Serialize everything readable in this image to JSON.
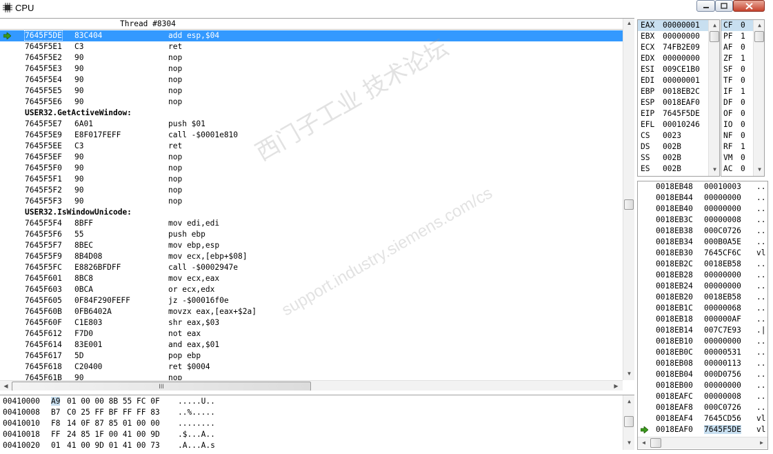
{
  "window": {
    "title": "CPU"
  },
  "disasm": {
    "header": "Thread #8304",
    "lines": [
      {
        "addr": "7645F5DE",
        "bytes": "83C404",
        "instr": "add esp,$04",
        "sel": true
      },
      {
        "addr": "7645F5E1",
        "bytes": "C3",
        "instr": "ret"
      },
      {
        "addr": "7645F5E2",
        "bytes": "90",
        "instr": "nop"
      },
      {
        "addr": "7645F5E3",
        "bytes": "90",
        "instr": "nop"
      },
      {
        "addr": "7645F5E4",
        "bytes": "90",
        "instr": "nop"
      },
      {
        "addr": "7645F5E5",
        "bytes": "90",
        "instr": "nop"
      },
      {
        "addr": "7645F5E6",
        "bytes": "90",
        "instr": "nop"
      },
      {
        "label": "USER32.GetActiveWindow:"
      },
      {
        "addr": "7645F5E7",
        "bytes": "6A01",
        "instr": "push $01"
      },
      {
        "addr": "7645F5E9",
        "bytes": "E8F017FEFF",
        "instr": "call -$0001e810"
      },
      {
        "addr": "7645F5EE",
        "bytes": "C3",
        "instr": "ret"
      },
      {
        "addr": "7645F5EF",
        "bytes": "90",
        "instr": "nop"
      },
      {
        "addr": "7645F5F0",
        "bytes": "90",
        "instr": "nop"
      },
      {
        "addr": "7645F5F1",
        "bytes": "90",
        "instr": "nop"
      },
      {
        "addr": "7645F5F2",
        "bytes": "90",
        "instr": "nop"
      },
      {
        "addr": "7645F5F3",
        "bytes": "90",
        "instr": "nop"
      },
      {
        "label": "USER32.IsWindowUnicode:"
      },
      {
        "addr": "7645F5F4",
        "bytes": "8BFF",
        "instr": "mov edi,edi"
      },
      {
        "addr": "7645F5F6",
        "bytes": "55",
        "instr": "push ebp"
      },
      {
        "addr": "7645F5F7",
        "bytes": "8BEC",
        "instr": "mov ebp,esp"
      },
      {
        "addr": "7645F5F9",
        "bytes": "8B4D08",
        "instr": "mov ecx,[ebp+$08]"
      },
      {
        "addr": "7645F5FC",
        "bytes": "E8826BFDFF",
        "instr": "call -$0002947e"
      },
      {
        "addr": "7645F601",
        "bytes": "8BC8",
        "instr": "mov ecx,eax"
      },
      {
        "addr": "7645F603",
        "bytes": "0BCA",
        "instr": "or ecx,edx"
      },
      {
        "addr": "7645F605",
        "bytes": "0F84F290FEFF",
        "instr": "jz -$00016f0e"
      },
      {
        "addr": "7645F60B",
        "bytes": "0FB6402A",
        "instr": "movzx eax,[eax+$2a]"
      },
      {
        "addr": "7645F60F",
        "bytes": "C1E803",
        "instr": "shr eax,$03"
      },
      {
        "addr": "7645F612",
        "bytes": "F7D0",
        "instr": "not eax"
      },
      {
        "addr": "7645F614",
        "bytes": "83E001",
        "instr": "and eax,$01"
      },
      {
        "addr": "7645F617",
        "bytes": "5D",
        "instr": "pop ebp"
      },
      {
        "addr": "7645F618",
        "bytes": "C20400",
        "instr": "ret $0004"
      },
      {
        "addr": "7645F61B",
        "bytes": "90",
        "instr": "nop"
      }
    ],
    "hscroll_grip": "III"
  },
  "dump": {
    "rows": [
      {
        "addr": "00410000",
        "first": "A9",
        "rest": "01 00 00 8B 55 FC 0F",
        "ascii": ".....U.."
      },
      {
        "addr": "00410008",
        "first": "B7",
        "rest": "C0 25 FF BF FF FF 83",
        "ascii": "..%....."
      },
      {
        "addr": "00410010",
        "first": "F8",
        "rest": "14 0F 87 85 01 00 00",
        "ascii": "........"
      },
      {
        "addr": "00410018",
        "first": "FF",
        "rest": "24 85 1F 00 41 00 9D",
        "ascii": ".$...A.."
      },
      {
        "addr": "00410020",
        "first": "01",
        "rest": "41 00 9D 01 41 00 73",
        "ascii": ".A...A.s"
      }
    ]
  },
  "registers": [
    {
      "name": "EAX",
      "value": "00000001",
      "hl": true
    },
    {
      "name": "EBX",
      "value": "00000000"
    },
    {
      "name": "ECX",
      "value": "74FB2E09"
    },
    {
      "name": "EDX",
      "value": "00000000"
    },
    {
      "name": "ESI",
      "value": "009CE1B0"
    },
    {
      "name": "EDI",
      "value": "00000001"
    },
    {
      "name": "EBP",
      "value": "0018EB2C"
    },
    {
      "name": "ESP",
      "value": "0018EAF0"
    },
    {
      "name": "EIP",
      "value": "7645F5DE"
    },
    {
      "name": "EFL",
      "value": "00010246"
    },
    {
      "name": "CS",
      "value": "0023"
    },
    {
      "name": "DS",
      "value": "002B"
    },
    {
      "name": "SS",
      "value": "002B"
    },
    {
      "name": "ES",
      "value": "002B"
    }
  ],
  "flags": [
    {
      "name": "CF",
      "value": "0",
      "hl": true
    },
    {
      "name": "PF",
      "value": "1"
    },
    {
      "name": "AF",
      "value": "0"
    },
    {
      "name": "ZF",
      "value": "1"
    },
    {
      "name": "SF",
      "value": "0"
    },
    {
      "name": "TF",
      "value": "0"
    },
    {
      "name": "IF",
      "value": "1"
    },
    {
      "name": "DF",
      "value": "0"
    },
    {
      "name": "OF",
      "value": "0"
    },
    {
      "name": "IO",
      "value": "0"
    },
    {
      "name": "NF",
      "value": "0"
    },
    {
      "name": "RF",
      "value": "1"
    },
    {
      "name": "VM",
      "value": "0"
    },
    {
      "name": "AC",
      "value": "0"
    }
  ],
  "stack": [
    {
      "addr": "0018EB48",
      "value": "00010003",
      "ascii": ".."
    },
    {
      "addr": "0018EB44",
      "value": "00000000",
      "ascii": ".."
    },
    {
      "addr": "0018EB40",
      "value": "00000000",
      "ascii": ".."
    },
    {
      "addr": "0018EB3C",
      "value": "00000008",
      "ascii": ".."
    },
    {
      "addr": "0018EB38",
      "value": "000C0726",
      "ascii": ".."
    },
    {
      "addr": "0018EB34",
      "value": "000B0A5E",
      "ascii": ".."
    },
    {
      "addr": "0018EB30",
      "value": "7645CF6C",
      "ascii": "vl"
    },
    {
      "addr": "0018EB2C",
      "value": "0018EB58",
      "ascii": ".."
    },
    {
      "addr": "0018EB28",
      "value": "00000000",
      "ascii": ".."
    },
    {
      "addr": "0018EB24",
      "value": "00000000",
      "ascii": ".."
    },
    {
      "addr": "0018EB20",
      "value": "0018EB58",
      "ascii": ".."
    },
    {
      "addr": "0018EB1C",
      "value": "00000068",
      "ascii": ".."
    },
    {
      "addr": "0018EB18",
      "value": "000000AF",
      "ascii": ".."
    },
    {
      "addr": "0018EB14",
      "value": "007C7E93",
      "ascii": ".|"
    },
    {
      "addr": "0018EB10",
      "value": "00000000",
      "ascii": ".."
    },
    {
      "addr": "0018EB0C",
      "value": "00000531",
      "ascii": ".."
    },
    {
      "addr": "0018EB08",
      "value": "00000113",
      "ascii": ".."
    },
    {
      "addr": "0018EB04",
      "value": "000D0756",
      "ascii": ".."
    },
    {
      "addr": "0018EB00",
      "value": "00000000",
      "ascii": ".."
    },
    {
      "addr": "0018EAFC",
      "value": "00000008",
      "ascii": ".."
    },
    {
      "addr": "0018EAF8",
      "value": "000C0726",
      "ascii": ".."
    },
    {
      "addr": "0018EAF4",
      "value": "7645CD56",
      "ascii": "vl"
    },
    {
      "addr": "0018EAF0",
      "value": "7645F5DE",
      "ascii": "vl",
      "current": true
    }
  ],
  "watermark": {
    "line1": "西门子工业 技术论坛",
    "line2": "support.industry.siemens.com/cs"
  }
}
